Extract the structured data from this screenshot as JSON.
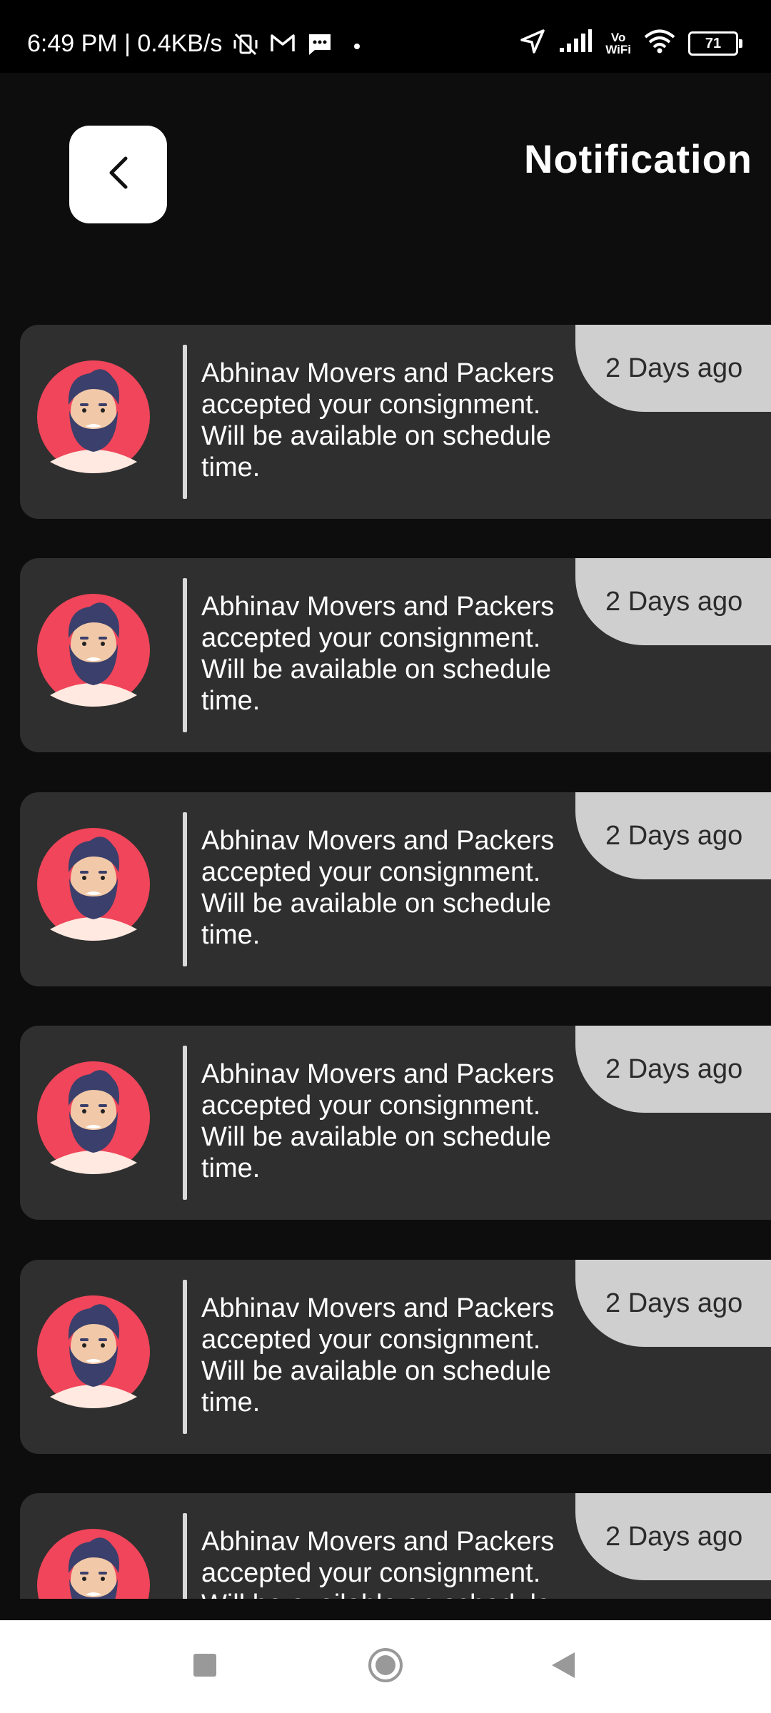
{
  "status_bar": {
    "time_speed": "6:49 PM | 0.4KB/s",
    "vowifi_top": "Vo",
    "vowifi_bottom": "WiFi",
    "battery": "71"
  },
  "header": {
    "title": "Notification"
  },
  "notifications": [
    {
      "message": "Abhinav Movers and Packers accepted your consignment. Will be available on schedule time.",
      "time": "2 Days ago"
    },
    {
      "message": "Abhinav Movers and Packers accepted your consignment. Will be available on schedule time.",
      "time": "2 Days ago"
    },
    {
      "message": "Abhinav Movers and Packers accepted your consignment. Will be available on schedule time.",
      "time": "2 Days ago"
    },
    {
      "message": "Abhinav Movers and Packers accepted your consignment. Will be available on schedule time.",
      "time": "2 Days ago"
    },
    {
      "message": "Abhinav Movers and Packers accepted your consignment. Will be available on schedule time.",
      "time": "2 Days ago"
    },
    {
      "message": "Abhinav Movers and Packers accepted your consignment. Will be available on schedule time.",
      "time": "2 Days ago"
    }
  ],
  "colors": {
    "background": "#0d0d0d",
    "card": "#2f2f2f",
    "badge": "#cfcfcf",
    "avatar_bg": "#f0455a",
    "hair": "#3a3f6b"
  },
  "icons": {
    "back": "chevron-left-icon",
    "nav_recents": "square-icon",
    "nav_home": "circle-icon",
    "nav_back": "triangle-back-icon"
  }
}
